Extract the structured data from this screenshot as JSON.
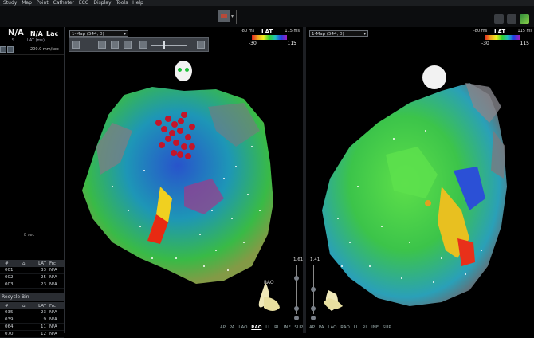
{
  "menubar": {
    "items": [
      "Study",
      "Map",
      "Point",
      "Catheter",
      "ECG",
      "Display",
      "Tools",
      "Help"
    ]
  },
  "left_panel": {
    "status": {
      "a": "N/A",
      "b": "N/A",
      "c": "Lac"
    },
    "status_labels": {
      "a": "LS",
      "b": "LAT (ms)",
      "c": ""
    },
    "speed": "200.0 mm/sec",
    "ecg_scale": "8 sec"
  },
  "points_table": {
    "headers": [
      "#",
      "",
      "LAT",
      "Frc"
    ],
    "rows": [
      {
        "id": "001",
        "lat": "33",
        "frc": "N/A"
      },
      {
        "id": "002",
        "lat": "25",
        "frc": "N/A"
      },
      {
        "id": "003",
        "lat": "23",
        "frc": "N/A"
      }
    ]
  },
  "recycle_bin": {
    "title": "Recycle Bin",
    "headers": [
      "#",
      "",
      "LAT",
      "Frc"
    ],
    "rows": [
      {
        "id": "035",
        "lat": "23",
        "frc": "N/A"
      },
      {
        "id": "039",
        "lat": "9",
        "frc": "N/A"
      },
      {
        "id": "064",
        "lat": "11",
        "frc": "N/A"
      },
      {
        "id": "070",
        "lat": "12",
        "frc": "N/A"
      }
    ]
  },
  "view1": {
    "map_select": "1-Map (544, 0)",
    "lat": {
      "title": "LAT",
      "min_label": "-80 ms",
      "max_label": "115 ms",
      "low": "-30",
      "high": "115"
    },
    "zoom": "1.61",
    "orientation": "RAO"
  },
  "view2": {
    "map_select": "1-Map (544, 0)",
    "lat": {
      "title": "LAT",
      "min_label": "-80 ms",
      "max_label": "115 ms",
      "low": "-30",
      "high": "115"
    },
    "zoom": "1.41"
  },
  "view_buttons": {
    "items": [
      "AP",
      "PA",
      "LAO",
      "RAO",
      "LL",
      "RL",
      "INF",
      "SUP"
    ],
    "active": "RAO"
  },
  "view_buttons2": {
    "items": [
      "AP",
      "PA",
      "LAO",
      "RAO",
      "LL",
      "RL",
      "INF",
      "SUP"
    ]
  },
  "colors": {
    "lat_red": "#e02020",
    "lat_purple": "#a020c0",
    "panel_header": "#2a2d32"
  }
}
